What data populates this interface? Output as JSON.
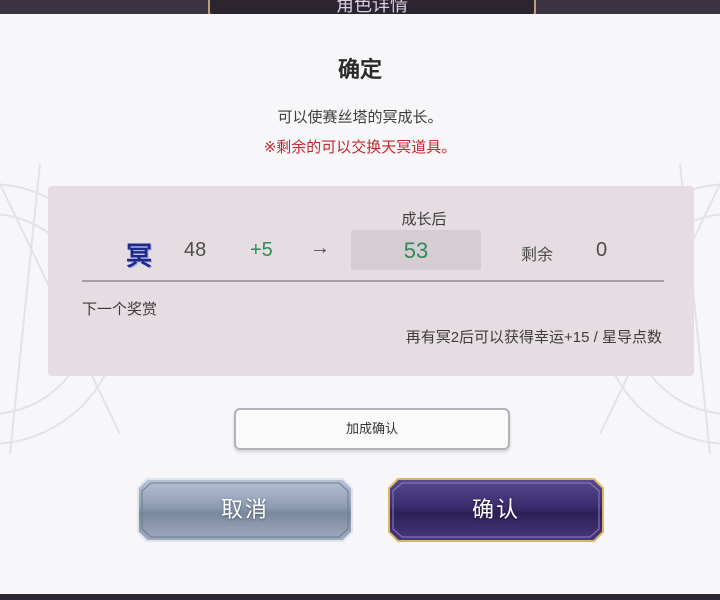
{
  "header": {
    "tab_title": "角色详情"
  },
  "dialog": {
    "title": "确定",
    "description": "可以使赛丝塔的冥成长。",
    "note": "※剩余的可以交换天冥道具。"
  },
  "growth": {
    "after_label": "成长后",
    "icon_char": "冥",
    "icon": "myo-emblem-icon",
    "current": "48",
    "plus": "+5",
    "arrow": "→",
    "result": "53",
    "remain_label": "剩余",
    "remain_value": "0"
  },
  "reward": {
    "label": "下一个奖赏",
    "text": "再有冥2后可以获得幸运+15 / 星导点数"
  },
  "buttons": {
    "bonus_confirm": "加成确认",
    "cancel": "取消",
    "confirm": "确认"
  },
  "colors": {
    "accent_red": "#c0282e",
    "value_green": "#2e8b57",
    "panel_bg": "#e6dde2"
  }
}
